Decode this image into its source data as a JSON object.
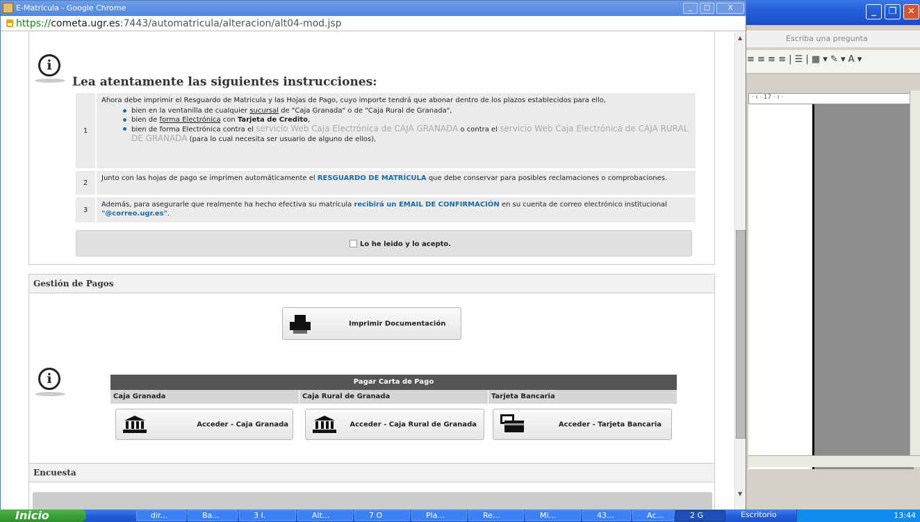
{
  "browser": {
    "window_title": "E-Matrícula - Google Chrome",
    "url_scheme": "https://",
    "url_host": "cometa.ugr.es",
    "url_rest": ":7443/automatricula/alteracion/alt04-mod.jsp",
    "controls": {
      "minimize": "_",
      "maximize": "□",
      "close": "X"
    }
  },
  "instructions": {
    "title": "Lea atentamente las siguientes instrucciones:",
    "rows": [
      {
        "num": "1",
        "intro": "Ahora debe imprimir el Resguardo de Matricula y las Hojas de Pago, cuyo importe tendrá que abonar dentro de los plazos establecidos para ello,",
        "b1_a": "bien en la ventanilla de cualquier ",
        "b1_link": "sucursal",
        "b1_b": " de \"Caja Granada\" o de \"Caja Rural de Granada\",",
        "b2_a": "bien de ",
        "b2_link": "forma Electrónica",
        "b2_b": " con ",
        "b2_bold": "Tarjeta de Credito",
        "b2_c": ",",
        "b3_a": "bien de forma Electrónica contra el ",
        "b3_link1": "servicio Web Caja Electrónica de CAJA GRANADA",
        "b3_b": " o contra el ",
        "b3_link2": "servicio Web Caja Electrónica de CAJA RURAL DE GRANADA",
        "b3_c": " (para lo cual necesita ser usuario de alguno de ellos),"
      },
      {
        "num": "2",
        "a": "Junto con las hojas de pago se imprimen automáticamente el ",
        "link": "RESGUARDO DE MATRÍCULA",
        "b": " que debe conservar para posibles reclamaciones o comprobaciones."
      },
      {
        "num": "3",
        "a": "Además, para asegurarle que realmente ha hecho efectiva su matrícula ",
        "link": "recibirá un EMAIL DE CONFIRMACIÓN",
        "b": " en su cuenta de correo electrónico institucional ",
        "link2": "\"@correo.ugr.es\"",
        "c": "."
      }
    ],
    "accept_label": "Lo he leido y lo acepto."
  },
  "pagos": {
    "header": "Gestión de Pagos",
    "print_button": "Imprimir Documentación",
    "table_title": "Pagar Carta de Pago",
    "columns": [
      "Caja Granada",
      "Caja Rural de Granada",
      "Tarjeta Bancaria"
    ],
    "buttons": [
      "Acceder - Caja Granada",
      "Acceder - Caja Rural de Granada",
      "Acceder - Tarjeta Bancaria"
    ]
  },
  "encuesta": {
    "header": "Encuesta"
  },
  "word": {
    "ask_placeholder": "Escriba una pregunta",
    "ruler": "· ı · 17 · ı ·"
  },
  "taskbar": {
    "start": "Inicio",
    "items": [
      "dir...",
      "Ba...",
      "3 I.",
      "Alt...",
      "7 O",
      "Pla...",
      "Re...",
      "Mi...",
      "43...",
      "Ac...",
      "2 G"
    ],
    "desktop": "Escritorio",
    "clock": "13:44"
  }
}
